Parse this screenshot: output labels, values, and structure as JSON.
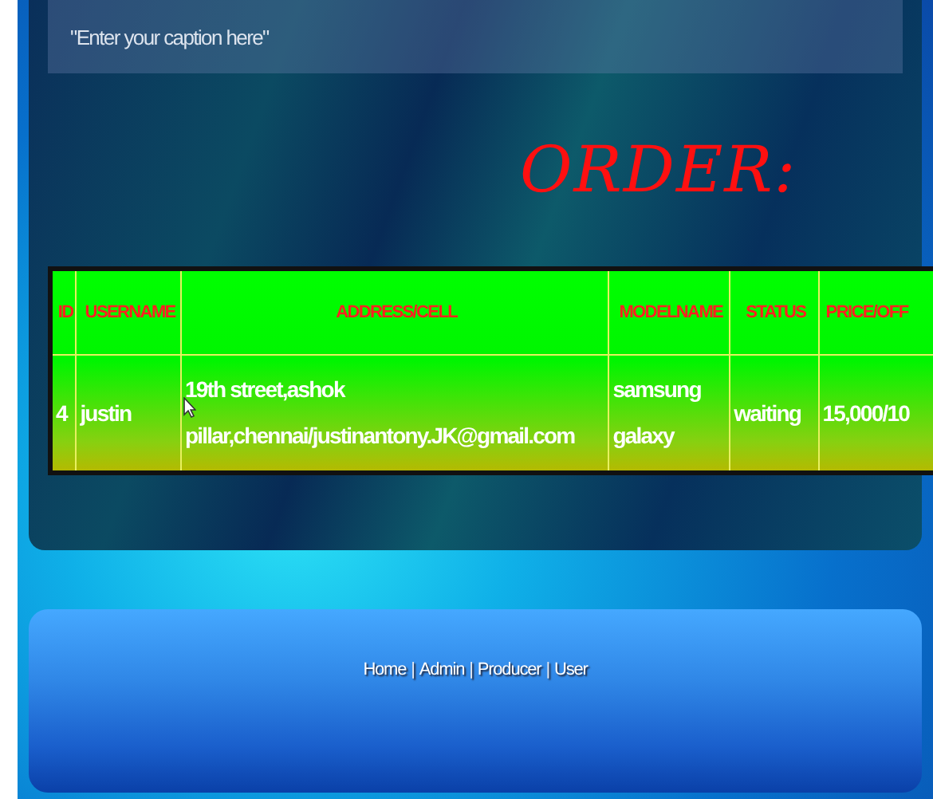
{
  "caption": {
    "placeholder": "\"Enter your caption here\""
  },
  "title": "ORDER:",
  "table": {
    "columns": [
      "ID",
      "USERNAME",
      "ADDRESS/CELL",
      "MODELNAME",
      "STATUS",
      "PRICE/OFF"
    ],
    "rows": [
      {
        "cells": [
          "4",
          "justin",
          "19th street,ashok pillar,chennai/justinantony.JK@gmail.com",
          "samsung galaxy",
          "waiting",
          "15,000/10"
        ]
      }
    ]
  },
  "footer": {
    "items": [
      {
        "kind": "link",
        "text": "Home"
      },
      {
        "kind": "separator",
        "text": "|"
      },
      {
        "kind": "link",
        "text": "Admin"
      },
      {
        "kind": "separator",
        "text": "|"
      },
      {
        "kind": "link",
        "text": "Producer"
      },
      {
        "kind": "separator",
        "text": "|"
      },
      {
        "kind": "link",
        "text": "User"
      }
    ]
  }
}
